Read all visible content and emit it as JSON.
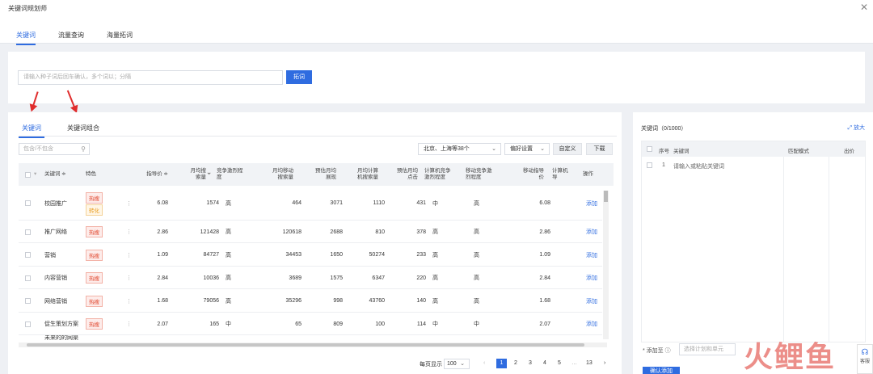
{
  "app": {
    "title": "关键词规划师",
    "close": "✕"
  },
  "top_tabs": [
    {
      "label": "关键词"
    },
    {
      "label": "流量查询"
    },
    {
      "label": "海量拓词"
    }
  ],
  "search": {
    "placeholder": "请输入种子词后回车确认，多个词以；分隔",
    "button": "拓词"
  },
  "sub_tabs": [
    {
      "label": "关键词"
    },
    {
      "label": "关键词组合"
    }
  ],
  "filter": {
    "placeholder": "包含/不包含"
  },
  "toolbar": {
    "region": "北京、上海等38个",
    "preference": "偏好设置",
    "customize": "自定义",
    "download": "下载"
  },
  "table": {
    "headers": {
      "keyword": "关键词 ≑",
      "feature": "特色",
      "index": "指导价 ≑",
      "monthly": "月均搜\n索量",
      "competition": "竞争激烈程\n度",
      "mobile_monthly": "月均移动\n搜索量",
      "est_show": "预估月均\n展现",
      "pc_search": "月均计算\n机搜索量",
      "est_click": "预估月均\n点击",
      "pc_comp": "计算机竞争\n激烈程度",
      "mobile_comp": "移动竞争激\n烈程度",
      "mobile_price": "移动指导\n价",
      "pc_price": "计算机\n导",
      "action": "操作"
    },
    "rows": [
      {
        "keyword": "校园推广",
        "tags": [
          "热搜",
          "转化"
        ],
        "index": "6.08",
        "monthly": "1574",
        "competition": "高",
        "mobile_monthly": "464",
        "est_show": "3071",
        "pc_search": "1110",
        "est_click": "431",
        "pc_comp": "中",
        "mobile_comp": "高",
        "mobile_price": "6.08",
        "action": "添加"
      },
      {
        "keyword": "推广网络",
        "tags": [
          "热搜"
        ],
        "index": "2.86",
        "monthly": "121428",
        "competition": "高",
        "mobile_monthly": "120618",
        "est_show": "2688",
        "pc_search": "810",
        "est_click": "378",
        "pc_comp": "高",
        "mobile_comp": "高",
        "mobile_price": "2.86",
        "action": "添加"
      },
      {
        "keyword": "营销",
        "tags": [
          "热搜"
        ],
        "index": "1.09",
        "monthly": "84727",
        "competition": "高",
        "mobile_monthly": "34453",
        "est_show": "1650",
        "pc_search": "50274",
        "est_click": "233",
        "pc_comp": "高",
        "mobile_comp": "高",
        "mobile_price": "1.09",
        "action": "添加"
      },
      {
        "keyword": "内容营销",
        "tags": [
          "热搜"
        ],
        "index": "2.84",
        "monthly": "10036",
        "competition": "高",
        "mobile_monthly": "3689",
        "est_show": "1575",
        "pc_search": "6347",
        "est_click": "220",
        "pc_comp": "高",
        "mobile_comp": "高",
        "mobile_price": "2.84",
        "action": "添加"
      },
      {
        "keyword": "网络营销",
        "tags": [
          "热搜"
        ],
        "index": "1.68",
        "monthly": "79056",
        "competition": "高",
        "mobile_monthly": "35296",
        "est_show": "998",
        "pc_search": "43760",
        "est_click": "140",
        "pc_comp": "高",
        "mobile_comp": "高",
        "mobile_price": "1.68",
        "action": "添加"
      },
      {
        "keyword": "促生策划方案",
        "tags": [
          "热搜"
        ],
        "index": "2.07",
        "monthly": "165",
        "competition": "中",
        "mobile_monthly": "65",
        "est_show": "809",
        "pc_search": "100",
        "est_click": "114",
        "pc_comp": "中",
        "mobile_comp": "中",
        "mobile_price": "2.07",
        "action": "添加"
      }
    ],
    "partial_row": "未来的的网渠"
  },
  "pager": {
    "per_page_label": "每页显示",
    "per_page": "100",
    "pages": [
      "1",
      "2",
      "3",
      "4",
      "5",
      "…",
      "13"
    ],
    "prev": "‹",
    "next": "›"
  },
  "right_panel": {
    "title": "关键词（0/1000）",
    "expand": "⤢ 放大",
    "headers": {
      "seq": "序号",
      "keyword": "关键词",
      "match": "匹配模式",
      "bid": "出价"
    },
    "row_index": "1",
    "row_placeholder": "请输入或粘贴关键词",
    "add_to_label": "* 添加至 ⓘ",
    "plan_placeholder": "选择计划和单元",
    "confirm": "确认添加"
  },
  "watermark": "火鲤鱼",
  "service": "客服"
}
